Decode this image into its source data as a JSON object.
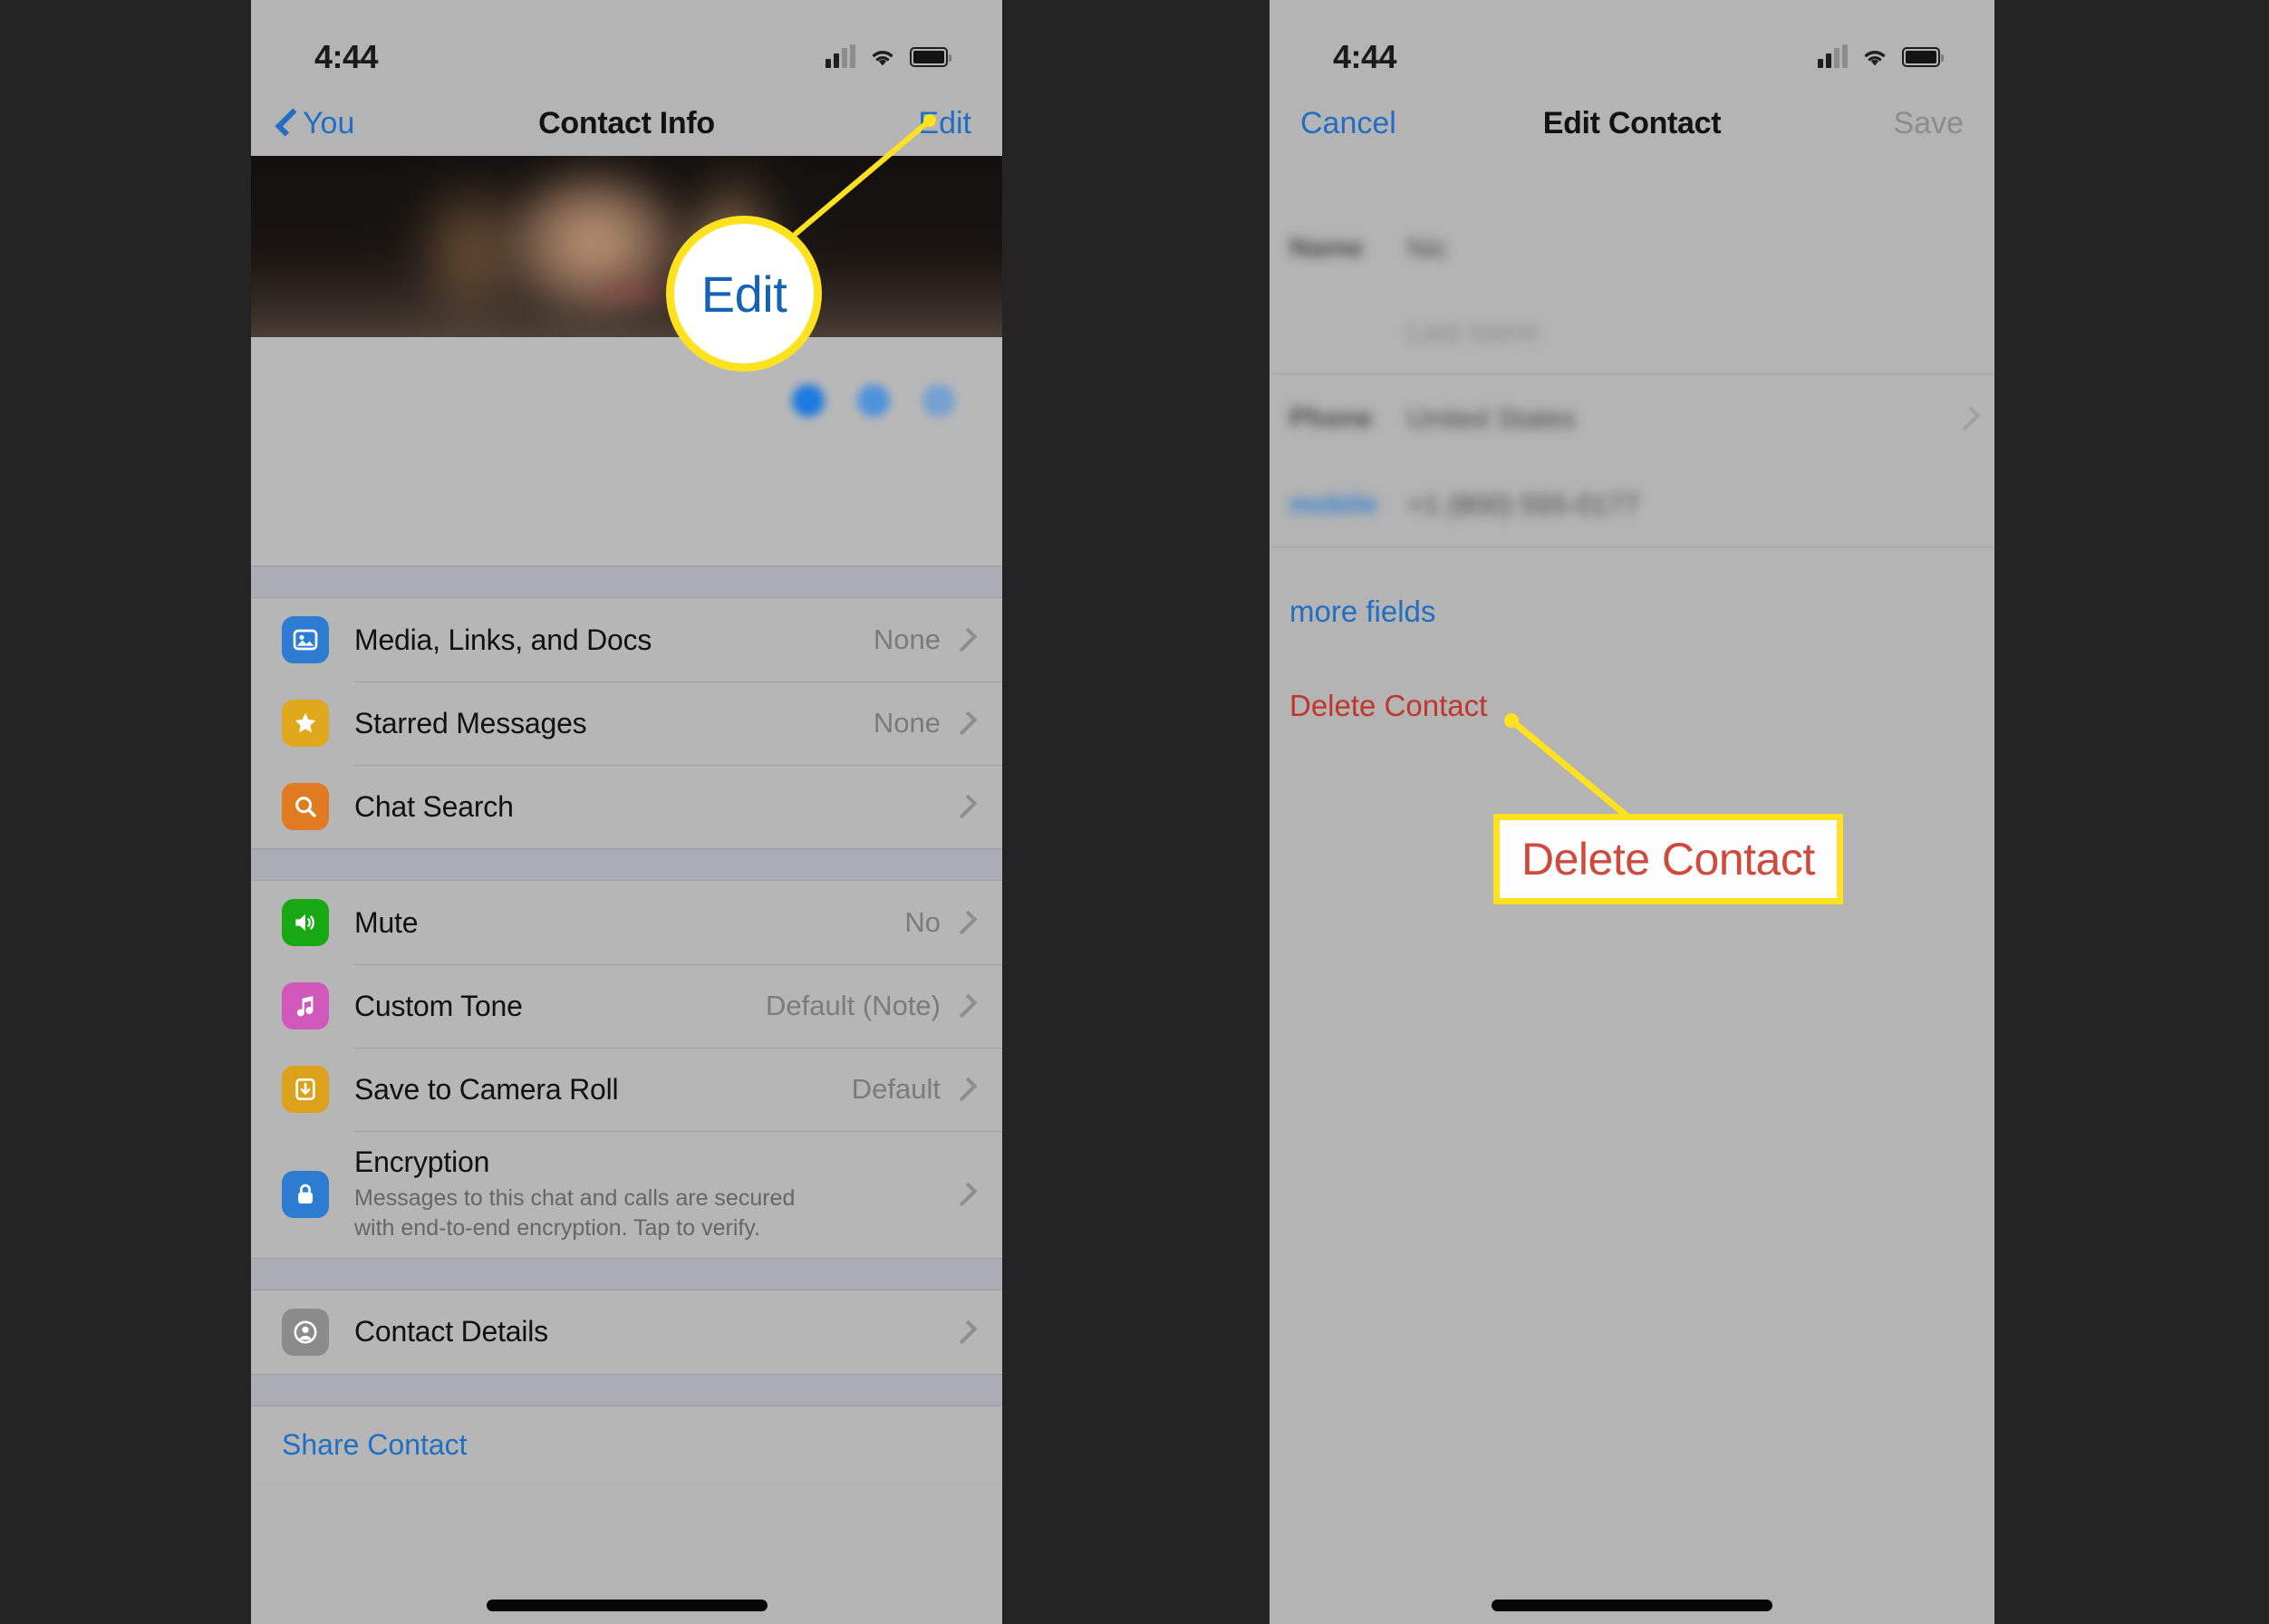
{
  "background_color": "#242424",
  "screens": [
    {
      "id": "contact-info",
      "status_bar": {
        "time": "4:44"
      },
      "nav": {
        "back_label": "You",
        "title": "Contact Info",
        "action_label": "Edit"
      },
      "profile": {
        "redacted": true
      },
      "groups": [
        {
          "rows": [
            {
              "label": "Media, Links, and Docs",
              "value": "None",
              "icon": "photo-icon",
              "icon_color": "#2c7dd2",
              "chevron": true
            },
            {
              "label": "Starred Messages",
              "value": "None",
              "icon": "star-icon",
              "icon_color": "#e0a81c",
              "chevron": true
            },
            {
              "label": "Chat Search",
              "value": "",
              "icon": "search-icon",
              "icon_color": "#e07b22",
              "chevron": true
            }
          ]
        },
        {
          "rows": [
            {
              "label": "Mute",
              "value": "No",
              "icon": "speaker-icon",
              "icon_color": "#18a814",
              "chevron": true
            },
            {
              "label": "Custom Tone",
              "value": "Default (Note)",
              "icon": "music-note-icon",
              "icon_color": "#d158bb",
              "chevron": true
            },
            {
              "label": "Save to Camera Roll",
              "value": "Default",
              "icon": "download-icon",
              "icon_color": "#dda21b",
              "chevron": true
            },
            {
              "label": "Encryption",
              "value": "",
              "sub": "Messages to this chat and calls are secured with end-to-end encryption. Tap to verify.",
              "icon": "lock-icon",
              "icon_color": "#2c7dd2",
              "chevron": true
            }
          ]
        },
        {
          "rows": [
            {
              "label": "Contact Details",
              "value": "",
              "icon": "person-icon",
              "icon_color": "#8b8b8b",
              "chevron": true
            }
          ]
        },
        {
          "rows": [
            {
              "label": "Share Contact",
              "link": true
            }
          ]
        }
      ]
    },
    {
      "id": "edit-contact",
      "status_bar": {
        "time": "4:44"
      },
      "nav": {
        "cancel_label": "Cancel",
        "title": "Edit Contact",
        "save_label": "Save",
        "save_disabled": true
      },
      "form": {
        "fields": [
          {
            "label": "Name",
            "value": "Nic",
            "redacted": true
          },
          {
            "label": "",
            "placeholder": "Last name",
            "redacted": true
          },
          {
            "label": "Phone",
            "value": "United States",
            "redacted": true,
            "chevron": true
          },
          {
            "label": "mobile",
            "value": "+1 (800) 555-0177",
            "redacted": true,
            "label_is_link": true
          }
        ],
        "more_fields_label": "more fields",
        "delete_label": "Delete Contact"
      }
    }
  ],
  "annotations": [
    {
      "type": "circle-callout",
      "text": "Edit",
      "text_color": "#1663b5",
      "border_color": "#ffe21f",
      "points_to": "edit-nav-button"
    },
    {
      "type": "box-callout",
      "text": "Delete Contact",
      "text_color": "#cf4a3d",
      "border_color": "#ffe21f",
      "points_to": "delete-contact-link"
    }
  ]
}
